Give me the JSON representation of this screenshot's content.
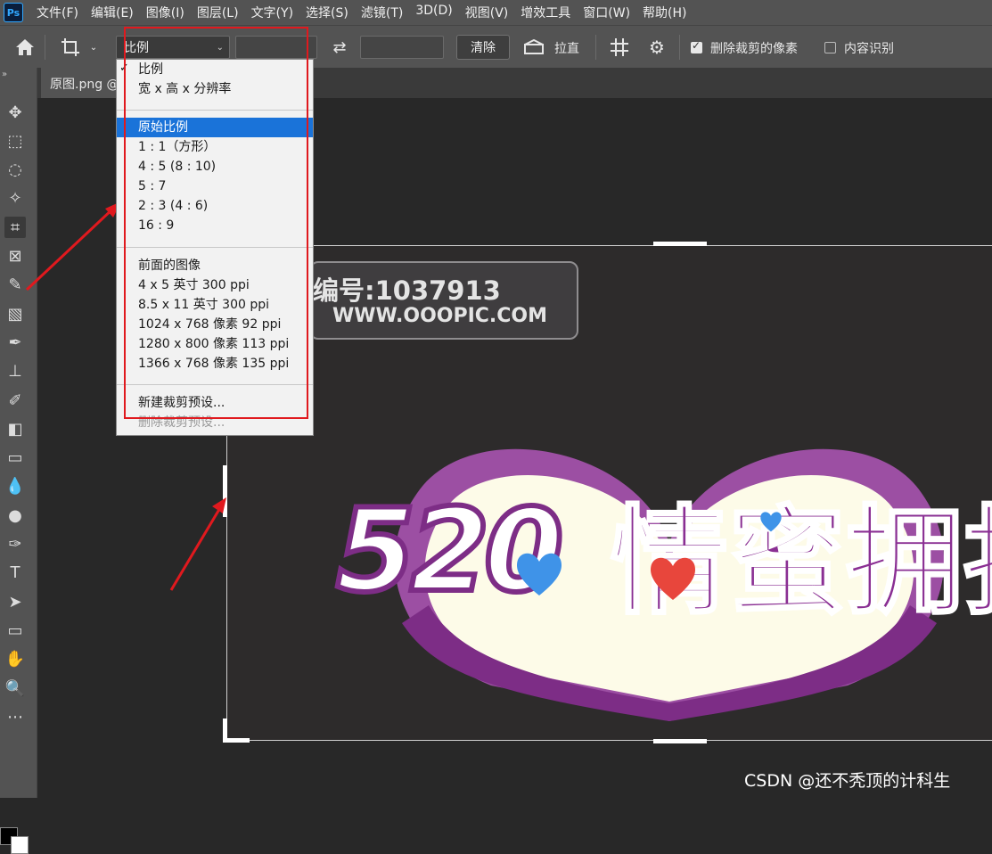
{
  "app": {
    "logo": "Ps"
  },
  "menu": [
    "文件(F)",
    "编辑(E)",
    "图像(I)",
    "图层(L)",
    "文字(Y)",
    "选择(S)",
    "滤镜(T)",
    "3D(D)",
    "视图(V)",
    "增效工具",
    "窗口(W)",
    "帮助(H)"
  ],
  "options": {
    "ratio_value": "比例",
    "clear_label": "清除",
    "straighten_label": "拉直",
    "delete_cropped_label": "删除裁剪的像素",
    "delete_cropped_checked": true,
    "content_aware_label": "内容识别",
    "content_aware_checked": false
  },
  "document": {
    "tab_label": "原图.png @"
  },
  "dropdown": {
    "group1": [
      "比例",
      "宽 x 高 x 分辨率"
    ],
    "checked_item": "比例",
    "group2": [
      "原始比例",
      "1 : 1（方形）",
      "4 : 5 (8 : 10)",
      "5 : 7",
      "2 : 3 (4 : 6)",
      "16 : 9"
    ],
    "selected_item": "原始比例",
    "group3": [
      "前面的图像",
      "4 x 5 英寸 300 ppi",
      "8.5 x 11 英寸 300 ppi",
      "1024 x 768 像素 92 ppi",
      "1280 x 800 像素 113 ppi",
      "1366 x 768 像素 135 ppi"
    ],
    "group4": [
      "新建裁剪预设...",
      "删除裁剪预设..."
    ],
    "disabled_item": "删除裁剪预设..."
  },
  "image": {
    "wm_line1": "编号:1037913",
    "wm_line2": "WWW.OOOPIC.COM",
    "banner_number": "520",
    "banner_text": "情蜜拥抱"
  },
  "footer_watermark": "CSDN @还不秃顶的计科生",
  "colors": {
    "annotation_red": "#e0191e",
    "selection_blue": "#1a73d9",
    "banner_purple": "#8a2f93"
  },
  "icons": {
    "toolbar": [
      "move-icon",
      "marquee-icon",
      "lasso-icon",
      "magic-wand-icon",
      "crop-icon",
      "frame-icon",
      "eyedropper-icon",
      "healing-brush-icon",
      "brush-icon",
      "stamp-icon",
      "history-brush-icon",
      "eraser-icon",
      "gradient-icon",
      "blur-icon",
      "dodge-icon",
      "pen-icon",
      "type-icon",
      "path-select-icon",
      "rectangle-icon",
      "hand-icon",
      "zoom-icon",
      "more-icon"
    ]
  }
}
